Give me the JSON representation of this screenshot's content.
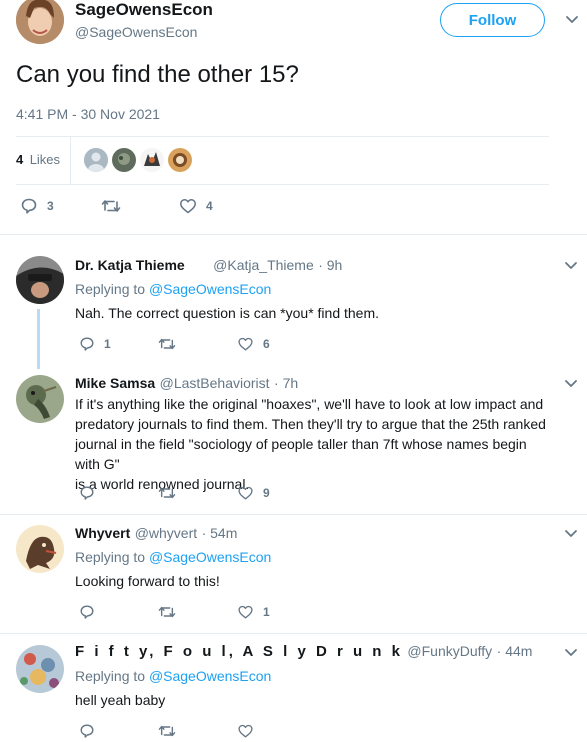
{
  "tweet": {
    "author_name": "SageOwensEcon",
    "author_handle": "@SageOwensEcon",
    "follow_label": "Follow",
    "text": "Can you find the other 15?",
    "timestamp": "4:41 PM - 30 Nov 2021",
    "likes_count": "4",
    "likes_label": "Likes",
    "reply_count": "3",
    "retweet_count": "",
    "like_count": "4"
  },
  "replies": [
    {
      "name": "Dr. Katja Thieme",
      "handle": "@Katja_Thieme",
      "time": "· 9h",
      "replying_prefix": "Replying to",
      "replying_to": "@SageOwensEcon",
      "text": "Nah. The correct question is can *you* find them.",
      "reply_count": "1",
      "like_count": "6"
    },
    {
      "name": "Mike Samsa",
      "handle": "@LastBehaviorist",
      "time": "· 7h",
      "lines": [
        "If it's anything like the original \"hoaxes\", we'll have to look at low impact and",
        "predatory journals to find them. Then they'll try to argue that the 25th ranked",
        "journal in the field \"sociology of people taller than 7ft whose names begin with G\"",
        "is a world renowned journal."
      ],
      "like_count": "9"
    },
    {
      "name": "Whyvert",
      "handle": "@whyvert",
      "time": "· 54m",
      "replying_prefix": "Replying to",
      "replying_to": "@SageOwensEcon",
      "text": "Looking forward to this!",
      "like_count": "1"
    },
    {
      "name": "F i f t y, F o u l, A S l y D r u n k",
      "handle": "@FunkyDuffy",
      "time": "· 44m",
      "replying_prefix": "Replying to",
      "replying_to": "@SageOwensEcon",
      "text": "hell yeah baby"
    }
  ],
  "icons": {
    "reply": "reply-icon",
    "retweet": "retweet-icon",
    "like": "heart-icon",
    "more": "chevron-down-icon"
  },
  "colors": {
    "accent": "#1da1f2",
    "muted": "#657786",
    "text": "#14171a",
    "divider": "#e6ecf0",
    "thread": "#b9dcf5"
  }
}
